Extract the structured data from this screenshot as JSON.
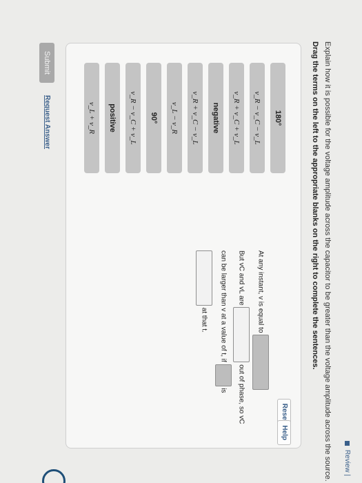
{
  "header": {
    "review_label": "Review |"
  },
  "question": {
    "line1": "Explain how it is possible for the voltage amplitude across the capacitor to be greater than the voltage amplitude across the source.",
    "line2": "Drag the terms on the left to the appropriate blanks on the right to complete the sentences."
  },
  "buttons": {
    "reset": "Reset",
    "help": "Help",
    "submit": "Submit",
    "request_answer": "Request Answer"
  },
  "terms": [
    {
      "text": "180°",
      "style": "bold"
    },
    {
      "text": "v_R − v_C − v_L",
      "style": "math"
    },
    {
      "text": "v_R + v_C + v_L",
      "style": "math"
    },
    {
      "text": "negative",
      "style": "bold"
    },
    {
      "text": "v_R + v_C − v_L",
      "style": "math"
    },
    {
      "text": "v_L − v_R",
      "style": "math"
    },
    {
      "text": "90°",
      "style": "bold"
    },
    {
      "text": "v_R − v_C + v_L",
      "style": "math"
    },
    {
      "text": "positive",
      "style": "bold"
    },
    {
      "text": "v_L + v_R",
      "style": "math"
    }
  ],
  "sentences": {
    "s1_prefix": "At any instant, v is equal to",
    "s2_prefix": "But vC and vL are",
    "s2_suffix": "out of phase, so vC",
    "s3_prefix": "can be larger than v at a value of t, if",
    "s3_suffix": "is",
    "s4_suffix": "at that t."
  }
}
